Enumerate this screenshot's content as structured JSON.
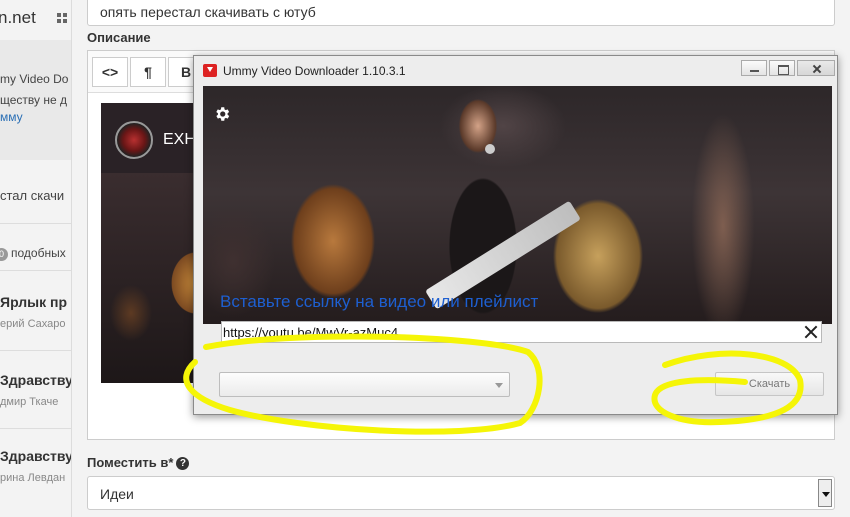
{
  "background_page": {
    "site": "n.net",
    "left_texts": [
      "my Video Do",
      "ществу не д",
      "мму",
      "стал скачи",
      "подобных",
      "Ярлык пр",
      "ерий Сахаро",
      "Здравству",
      "дмир Ткаче",
      "Здравству",
      "рина Левдан"
    ],
    "badge_count": "0",
    "subject_value": "опять перестал скачивать с ютуб",
    "description_label": "Описание",
    "toolbar": {
      "code": "<>",
      "paragraph": "¶",
      "bold": "B"
    },
    "embed_title": "EXH",
    "place_label": "Поместить в*",
    "help_glyph": "?",
    "place_value": "Идеи"
  },
  "ummy": {
    "title": "Ummy Video Downloader 1.10.3.1",
    "prompt": "Вставьте ссылку на видео или плейлист",
    "url_value": "https://youtu.be/MwVr-azMuc4",
    "download_label": "Скачать",
    "format_selected": ""
  },
  "colors": {
    "prompt": "#1e5fd0",
    "annotation": "#f5f507"
  }
}
